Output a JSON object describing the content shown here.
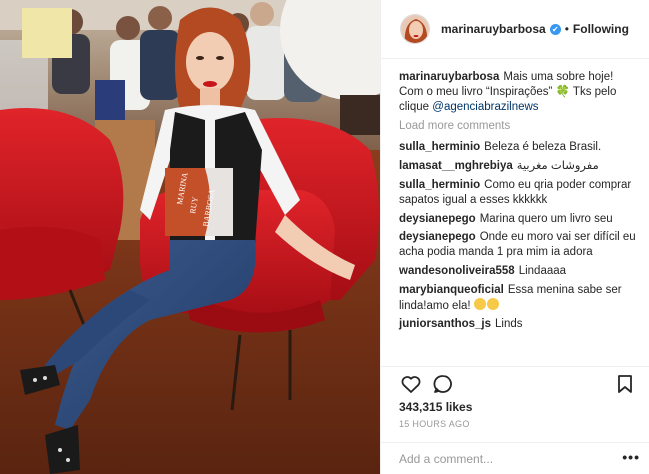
{
  "post": {
    "author": "marinaruybarbosa",
    "follow_status": "Following",
    "separator": "•",
    "verified_mark": "✔",
    "caption": {
      "user": "marinaruybarbosa",
      "text_before": "Mais uma sobre hoje! Com o meu livro “Inspirações”",
      "clover": "🍀",
      "text_after": "Tks pelo clique",
      "mention": "@agenciabrazilnews"
    },
    "load_more_label": "Load more comments",
    "comments": [
      {
        "user": "sulla_herminio",
        "text": "Beleza é beleza Brasil."
      },
      {
        "user": "lamasat__mghrebiya",
        "text": "مفروشات مغربية"
      },
      {
        "user": "sulla_herminio",
        "text": "Como eu qria poder comprar sapatos igual a esses kkkkkk"
      },
      {
        "user": "deysianepego",
        "text": "Marina quero um livro seu"
      },
      {
        "user": "deysianepego",
        "text": "Onde eu moro vai ser difícil eu acha podia manda 1 pra mim ia adora"
      },
      {
        "user": "wandesonoliveira558",
        "text": "Lindaaaa"
      },
      {
        "user": "marybianqueoficial",
        "text": "Essa menina sabe ser linda!amo ela!"
      },
      {
        "user": "juniorsanthos_js",
        "text": "Linds"
      }
    ],
    "likes": "343,315 likes",
    "time": "15 HOURS AGO",
    "add_comment_placeholder": "Add a comment...",
    "more_options": "•••",
    "icons": {
      "like": "heart-icon",
      "comment": "comment-bubble-icon",
      "save": "bookmark-icon",
      "more": "more-options-icon"
    },
    "photo_book": {
      "line1": "MARINA",
      "line2": "RUY",
      "line3": "BARBOSA"
    },
    "colors": {
      "verified": "#3897f0",
      "mention": "#003569",
      "muted": "#999999",
      "text": "#262626",
      "chair_red": "#c8141b"
    }
  }
}
